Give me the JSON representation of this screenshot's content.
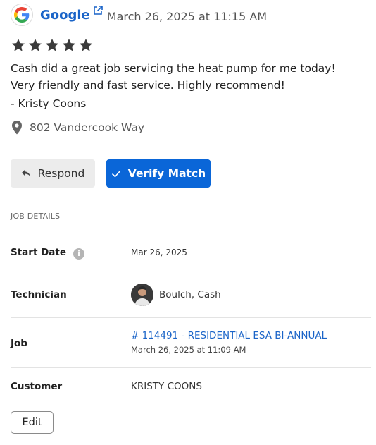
{
  "review": {
    "source": "Google",
    "source_icon": "google-g-icon",
    "date": "March 26, 2025 at 11:15 AM",
    "rating": 5,
    "max_rating": 5,
    "text": "Cash did a great job servicing the heat pump for me today! Very friendly and fast service. Highly recommend!",
    "author": "- Kristy Coons",
    "address": "802 Vandercook Way"
  },
  "actions": {
    "respond_label": "Respond",
    "verify_label": "Verify Match"
  },
  "job_details": {
    "section_title": "JOB DETAILS",
    "start_date_label": "Start Date",
    "start_date_value": "Mar 26, 2025",
    "technician_label": "Technician",
    "technician_value": "Boulch, Cash",
    "job_label": "Job",
    "job_link": "# 114491 - RESIDENTIAL ESA BI-ANNUAL",
    "job_datetime": "March 26, 2025 at 11:09 AM",
    "customer_label": "Customer",
    "customer_value": "KRISTY COONS",
    "edit_label": "Edit"
  },
  "colors": {
    "accent": "#0a66d8",
    "link": "#1a64c8",
    "star": "#3b3b3b"
  }
}
